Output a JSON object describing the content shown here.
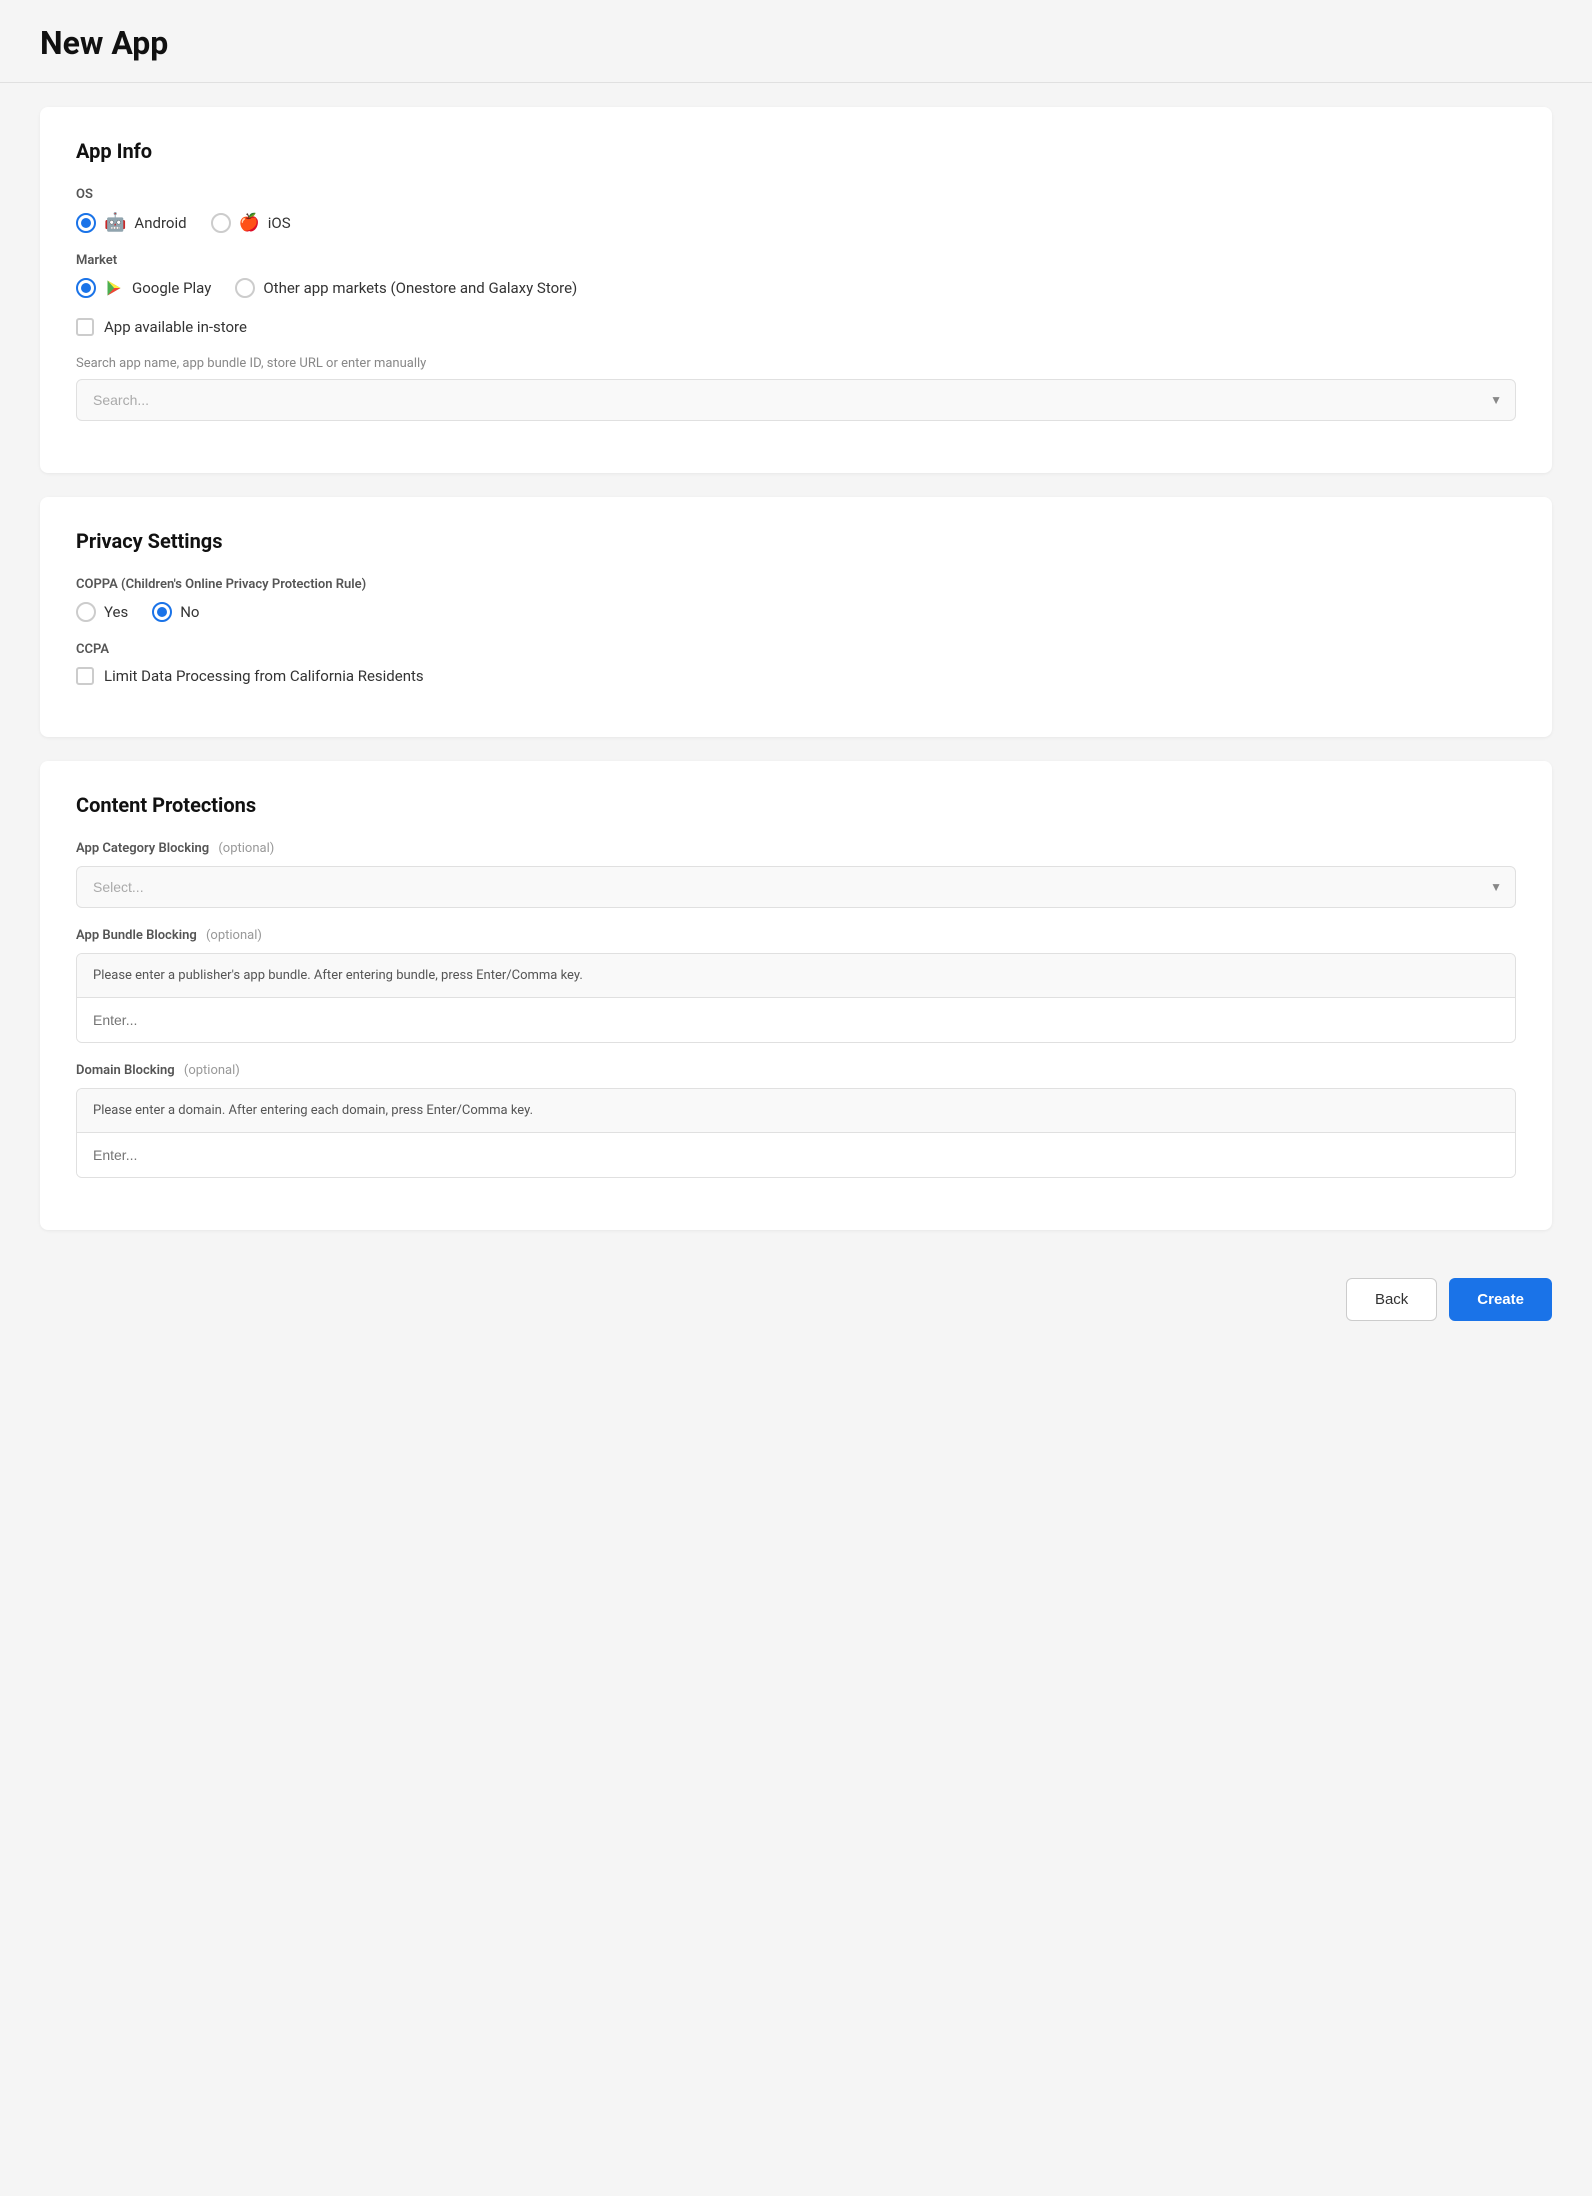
{
  "page": {
    "title": "New App"
  },
  "appInfo": {
    "section_title": "App Info",
    "os_label": "OS",
    "os_options": [
      {
        "id": "android",
        "label": "Android",
        "selected": true
      },
      {
        "id": "ios",
        "label": "iOS",
        "selected": false
      }
    ],
    "market_label": "Market",
    "market_options": [
      {
        "id": "google_play",
        "label": "Google Play",
        "selected": true
      },
      {
        "id": "other",
        "label": "Other app markets (Onestore and Galaxy Store)",
        "selected": false
      }
    ],
    "app_available_label": "App available in-store",
    "search_hint": "Search app name, app bundle ID, store URL or enter manually",
    "search_placeholder": "Search..."
  },
  "privacySettings": {
    "section_title": "Privacy Settings",
    "coppa_label": "COPPA (Children's Online Privacy Protection Rule)",
    "coppa_options": [
      {
        "id": "yes",
        "label": "Yes",
        "selected": false
      },
      {
        "id": "no",
        "label": "No",
        "selected": true
      }
    ],
    "ccpa_label": "CCPA",
    "ccpa_checkbox_label": "Limit Data Processing from California Residents"
  },
  "contentProtections": {
    "section_title": "Content Protections",
    "category_blocking_label": "App Category Blocking",
    "category_blocking_optional": "(optional)",
    "category_blocking_placeholder": "Select...",
    "bundle_blocking_label": "App Bundle Blocking",
    "bundle_blocking_optional": "(optional)",
    "bundle_blocking_hint": "Please enter a publisher's app bundle. After entering bundle, press Enter/Comma key.",
    "bundle_blocking_placeholder": "Enter...",
    "domain_blocking_label": "Domain Blocking",
    "domain_blocking_optional": "(optional)",
    "domain_blocking_hint": "Please enter a domain. After entering each domain, press Enter/Comma key.",
    "domain_blocking_placeholder": "Enter..."
  },
  "footer": {
    "back_label": "Back",
    "create_label": "Create"
  }
}
